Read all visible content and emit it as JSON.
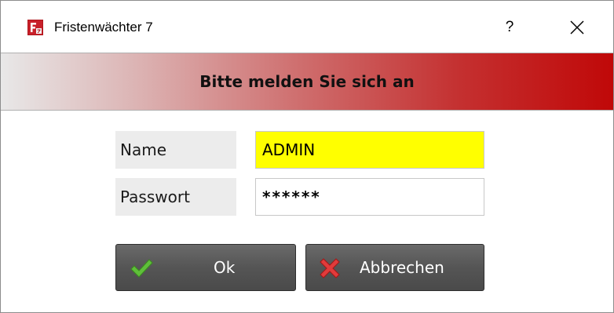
{
  "window": {
    "title": "Fristenwächter 7",
    "help_label": "?",
    "icons": {
      "app": "fristenwaechter-app-icon",
      "close": "close-icon"
    }
  },
  "banner": {
    "text": "Bitte melden Sie sich an",
    "colors": {
      "start": "#e8e8e8",
      "end": "#c00808"
    }
  },
  "form": {
    "name_label": "Name",
    "name_value": "ADMIN",
    "name_field_color": "#ffff00",
    "password_label": "Passwort",
    "password_value": "******"
  },
  "buttons": {
    "ok_label": "Ok",
    "ok_icon": "checkmark-icon",
    "cancel_label": "Abbrechen",
    "cancel_icon": "red-x-icon"
  }
}
